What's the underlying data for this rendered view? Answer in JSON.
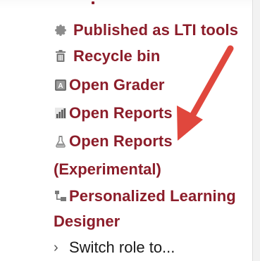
{
  "menu": {
    "items": [
      {
        "label": "Published as LTI tools",
        "icon": "gear-icon"
      },
      {
        "label": "Recycle bin",
        "icon": "trash-icon"
      },
      {
        "label": "Open Grader",
        "icon": "grader-icon"
      },
      {
        "label": "Open Reports",
        "icon": "bar-chart-icon"
      },
      {
        "label_line1": "Open Reports",
        "label_line2": "(Experimental)",
        "icon": "flask-icon"
      },
      {
        "label_line1": "Personalized Learning",
        "label_line2": "Designer",
        "icon": "sitemap-icon"
      }
    ],
    "switch_role": {
      "label": "Switch role to...",
      "icon": "chevron-right-icon"
    }
  },
  "colors": {
    "link": "#8c1d2a",
    "text": "#1a1a1a",
    "arrow": "#e0473d"
  }
}
